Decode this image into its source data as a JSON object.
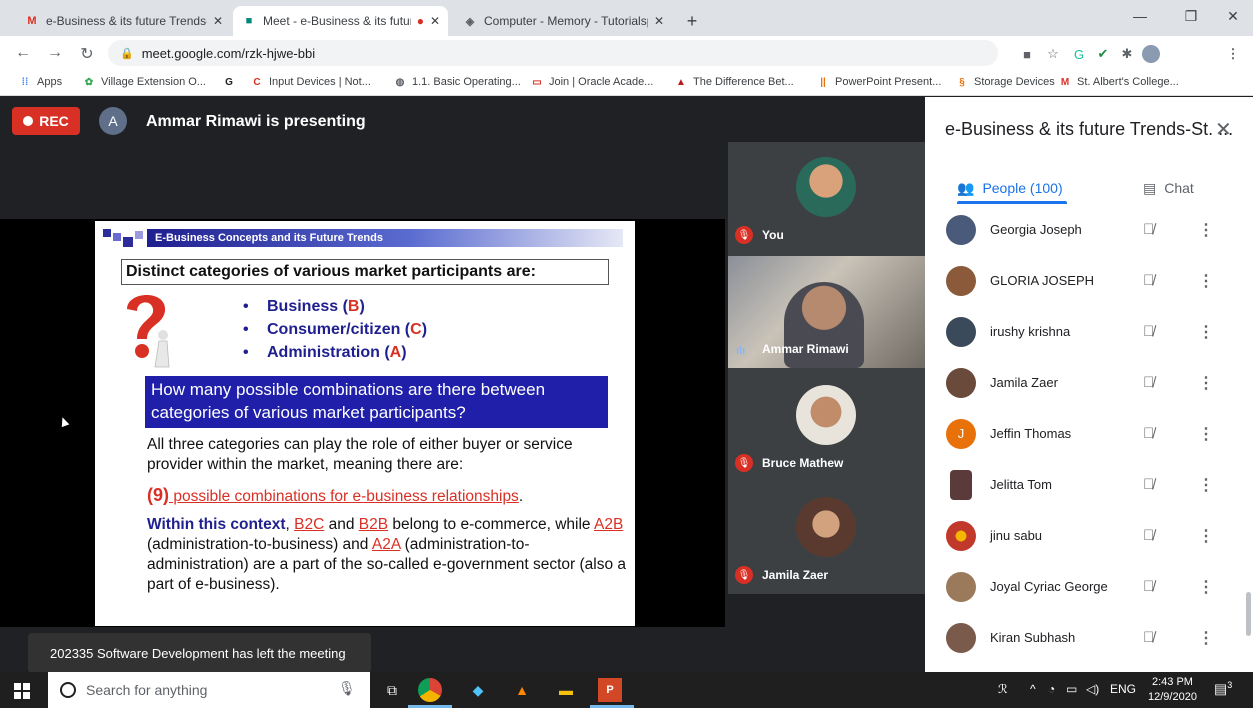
{
  "tabs": [
    {
      "label": "e-Business & its future Trends-St",
      "favicon": "gmail-icon"
    },
    {
      "label": "Meet - e-Business & its futur",
      "favicon": "meet-icon",
      "active": true
    },
    {
      "label": "Computer - Memory - Tutorialsp",
      "favicon": "tutorialspoint-icon"
    }
  ],
  "address": {
    "url": "meet.google.com/rzk-hjwe-bbi"
  },
  "bookmarks": [
    {
      "label": "Apps"
    },
    {
      "label": "Village Extension O..."
    },
    {
      "label": ""
    },
    {
      "label": "Input Devices | Not..."
    },
    {
      "label": "1.1. Basic Operating..."
    },
    {
      "label": "Join | Oracle Acade..."
    },
    {
      "label": "The Difference Bet..."
    },
    {
      "label": "PowerPoint Present..."
    },
    {
      "label": "Storage Devices"
    },
    {
      "label": "St. Albert's College..."
    }
  ],
  "meet": {
    "rec_label": "REC",
    "presenter_initial": "A",
    "presenter_text": "Ammar Rimawi is presenting",
    "toast": "202335 Software Development has left the meeting"
  },
  "slide": {
    "header": "E-Business Concepts and its Future Trends",
    "box_title": "Distinct categories of various market participants are:",
    "bullets": [
      {
        "text": "Business (",
        "letter": "B",
        "close": ")"
      },
      {
        "text": "Consumer/citizen (",
        "letter": "C",
        "close": ")"
      },
      {
        "text": "Administration (",
        "letter": "A",
        "close": ")"
      }
    ],
    "question": "How many possible combinations are there between categories of various market participants?",
    "para": "All three categories can play the role of either buyer or service provider within the market, meaning there are:",
    "combo_open": "(",
    "combo_number": "9",
    "combo_close": ")",
    "combo_text": " possible combinations for e-business relationships",
    "combo_end": ".",
    "ctx_lead": "Within this context",
    "ctx_1": ", ",
    "ctx_b2c": "B2C",
    "ctx_2": " and ",
    "ctx_b2b": "B2B",
    "ctx_3": " belong to e-commerce, while ",
    "ctx_a2b": "A2B",
    "ctx_4": " (administration-to-business) and ",
    "ctx_a2a": "A2A",
    "ctx_5": " (administration-to-administration) are a part of the so-called e-government sector (also a part of e-business)."
  },
  "tiles": [
    {
      "name": "You",
      "muted": true
    },
    {
      "name": "Ammar Rimawi",
      "speaking": true
    },
    {
      "name": "Bruce Mathew",
      "muted": true
    },
    {
      "name": "Jamila Zaer",
      "muted": true
    }
  ],
  "panel": {
    "title": "e-Business & its future Trends-St. ...",
    "people_tab": "People (100)",
    "chat_tab": "Chat",
    "people": [
      {
        "name": "Georgia Joseph",
        "color": "#4a5a7a"
      },
      {
        "name": "GLORIA JOSEPH",
        "color": "#8a5a3a"
      },
      {
        "name": "irushy krishna",
        "color": "#3a4a5a"
      },
      {
        "name": "Jamila Zaer",
        "color": "#6a4a3a"
      },
      {
        "name": "Jeffin Thomas",
        "color": "#e8710a",
        "initial": "J"
      },
      {
        "name": "Jelitta Tom",
        "color": "#5a3a3a"
      },
      {
        "name": "jinu sabu",
        "color": "#c0392b"
      },
      {
        "name": "Joyal Cyriac George",
        "color": "#9a7a5a"
      },
      {
        "name": "Kiran Subhash",
        "color": "#7a5a4a"
      }
    ]
  },
  "taskbar": {
    "search_placeholder": "Search for anything",
    "lang": "ENG",
    "time": "2:43 PM",
    "date": "12/9/2020",
    "notifications": "3"
  }
}
